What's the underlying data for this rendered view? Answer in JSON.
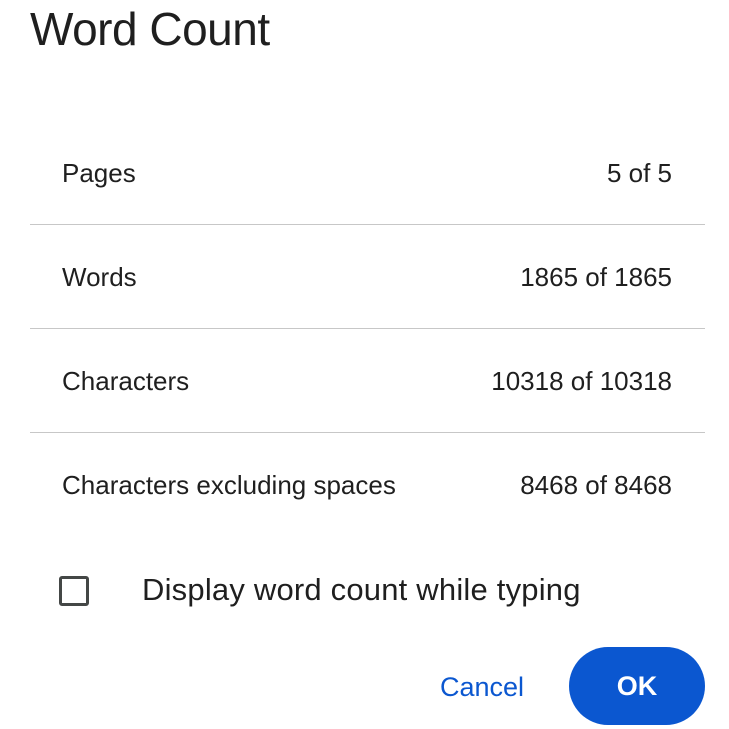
{
  "dialog": {
    "title": "Word Count"
  },
  "stats": [
    {
      "label": "Pages",
      "value": "5 of 5"
    },
    {
      "label": "Words",
      "value": "1865 of 1865"
    },
    {
      "label": "Characters",
      "value": "10318 of 10318"
    },
    {
      "label": "Characters excluding spaces",
      "value": "8468 of 8468"
    }
  ],
  "option": {
    "label": "Display word count while typing",
    "checked": false
  },
  "buttons": {
    "cancel_label": "Cancel",
    "ok_label": "OK"
  },
  "colors": {
    "accent": "#0b57d0",
    "text": "#1f1f1f",
    "divider": "#c7c7c7",
    "checkbox_border": "#444746"
  }
}
